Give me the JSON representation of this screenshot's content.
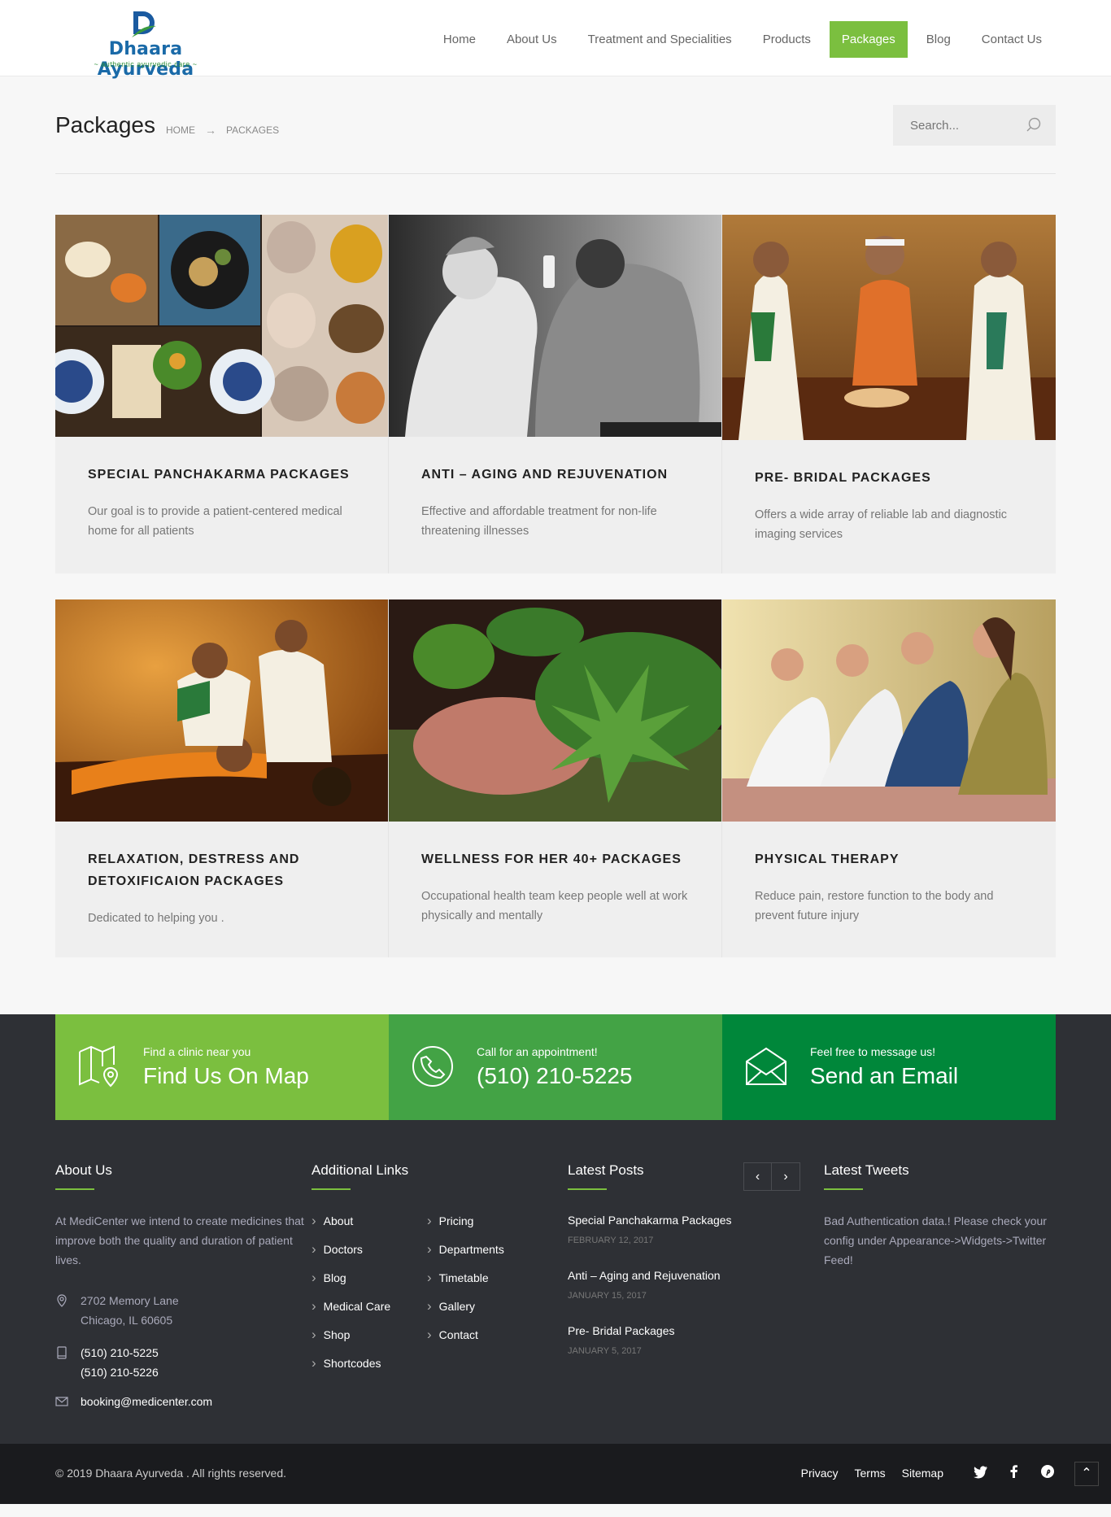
{
  "header": {
    "logo": {
      "brand": "Dhaara Ayurveda",
      "tagline": "~ authentic ayurvedic care ~"
    },
    "nav": [
      "Home",
      "About Us",
      "Treatment and Specialities",
      "Products",
      "Packages",
      "Blog",
      "Contact Us"
    ],
    "active_nav": "Packages"
  },
  "titlebar": {
    "title": "Packages",
    "breadcrumb": [
      "HOME",
      "PACKAGES"
    ],
    "search_placeholder": "Search..."
  },
  "packages": [
    {
      "title": "SPECIAL PANCHAKARMA PACKAGES",
      "desc": "Our goal is to provide a patient-centered medical home for all patients"
    },
    {
      "title": "ANTI – AGING AND REJUVENATION",
      "desc": "Effective and affordable treatment for non-life threatening illnesses"
    },
    {
      "title": "PRE- BRIDAL PACKAGES",
      "desc": "Offers a wide array of reliable lab and diagnostic imaging services"
    },
    {
      "title": "RELAXATION, DESTRESS AND DETOXIFICAION PACKAGES",
      "desc": "Dedicated to helping you ."
    },
    {
      "title": "WELLNESS FOR HER 40+ PACKAGES",
      "desc": "Occupational health team keep people well at work physically and mentally"
    },
    {
      "title": "PHYSICAL THERAPY",
      "desc": "Reduce pain, restore function to the body and prevent future injury"
    }
  ],
  "contact_strip": [
    {
      "small": "Find a clinic near you",
      "big": "Find Us On Map",
      "icon": "map-icon"
    },
    {
      "small": "Call for an appointment!",
      "big": "(510) 210-5225",
      "icon": "phone-icon"
    },
    {
      "small": "Feel free to message us!",
      "big": "Send an Email",
      "icon": "envelope-icon"
    }
  ],
  "footer": {
    "about": {
      "heading": "About Us",
      "text": "At MediCenter we intend to create medicines that improve both the quality and duration of patient lives.",
      "address1": "2702 Memory Lane",
      "address2": "Chicago, IL 60605",
      "phone1": "(510) 210-5225",
      "phone2": "(510) 210-5226",
      "email": "booking@medicenter.com"
    },
    "links": {
      "heading": "Additional Links",
      "col1": [
        "About",
        "Doctors",
        "Blog",
        "Medical Care",
        "Shop",
        "Shortcodes"
      ],
      "col2": [
        "Pricing",
        "Departments",
        "Timetable",
        "Gallery",
        "Contact"
      ]
    },
    "posts": {
      "heading": "Latest Posts",
      "items": [
        {
          "title": "Special Panchakarma Packages",
          "date": "FEBRUARY 12, 2017"
        },
        {
          "title": "Anti – Aging and Rejuvenation",
          "date": "JANUARY 15, 2017"
        },
        {
          "title": "Pre- Bridal Packages",
          "date": "JANUARY 5, 2017"
        }
      ]
    },
    "tweets": {
      "heading": "Latest Tweets",
      "text": "Bad Authentication data.! Please check your config under Appearance->Widgets->Twitter Feed!"
    }
  },
  "bottom": {
    "copyright": "© 2019 Dhaara Ayurveda . All rights reserved.",
    "links": [
      "Privacy",
      "Terms",
      "Sitemap"
    ],
    "social": [
      "twitter-icon",
      "facebook-icon",
      "pinterest-icon"
    ]
  },
  "colors": {
    "accent": "#7bbf3f",
    "green2": "#43a345",
    "green3": "#00873a",
    "dark": "#2e3035",
    "bottom": "#1a1b1e"
  }
}
